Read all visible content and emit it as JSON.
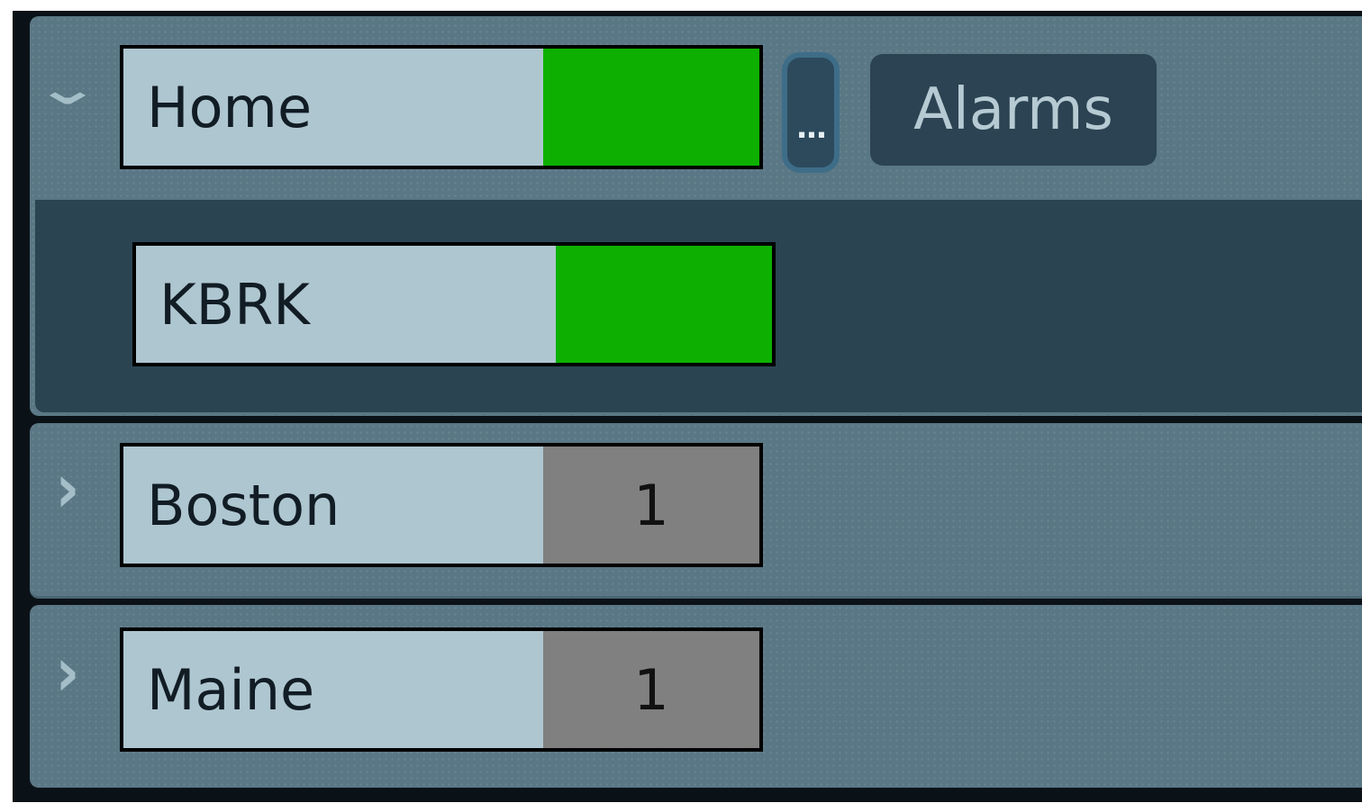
{
  "tree": {
    "home": {
      "label": "Home",
      "expanded": true,
      "status_color": "#0db000",
      "more_button_label": "...",
      "alarms_button_label": "Alarms",
      "children": [
        {
          "label": "KBRK",
          "status_color": "#0db000"
        }
      ]
    },
    "nodes": [
      {
        "label": "Boston",
        "count": "1",
        "status_color": "#808080",
        "expanded": false
      },
      {
        "label": "Maine",
        "count": "1",
        "status_color": "#808080",
        "expanded": false
      }
    ]
  },
  "icons": {
    "expanded": "chevron-down-icon",
    "collapsed": "chevron-right-icon"
  },
  "colors": {
    "ok": "#0db000",
    "count_bg": "#808080",
    "node_bg": "#aec6d0",
    "panel_bg": "#5a7785",
    "subpanel_bg": "#2b4452"
  }
}
